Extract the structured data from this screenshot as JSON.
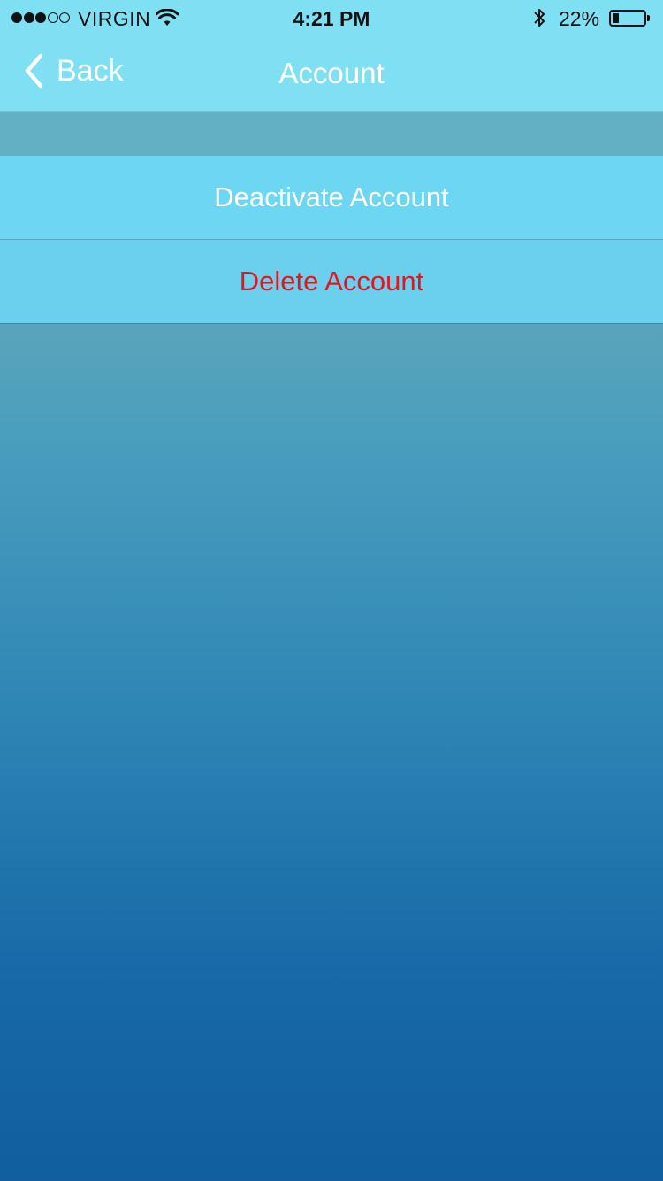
{
  "status_bar": {
    "carrier": "VIRGIN",
    "time": "4:21 PM",
    "battery_percent_label": "22%",
    "battery_level": 0.22,
    "signal_bars_filled": 3,
    "signal_bars_total": 5
  },
  "nav": {
    "back_label": "Back",
    "title": "Account"
  },
  "actions": {
    "deactivate_label": "Deactivate Account",
    "delete_label": "Delete Account"
  },
  "colors": {
    "header_bg": "#7fe0f3",
    "row_bg": "#6dd6f2",
    "delete_text": "#e8131c",
    "primary_text": "#ffffff"
  }
}
